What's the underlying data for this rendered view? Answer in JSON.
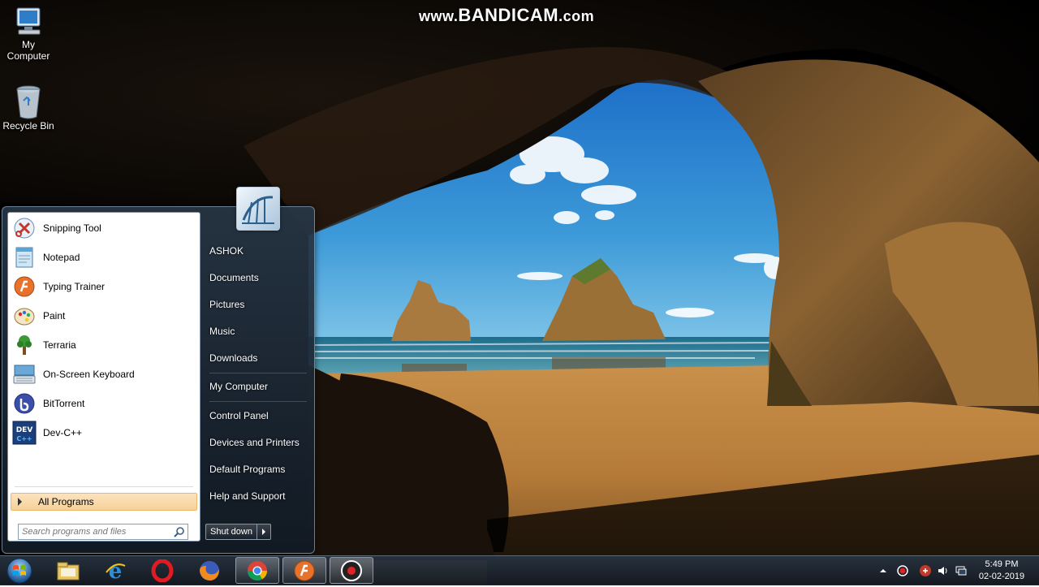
{
  "watermark": {
    "prefix": "www.",
    "brand": "BANDICAM",
    "suffix": ".com"
  },
  "desktop": {
    "icons": [
      {
        "label_line1": "My",
        "label_line2": "Computer",
        "icon": "computer-icon"
      },
      {
        "label_line1": "Recycle Bin",
        "label_line2": "",
        "icon": "recycle-bin-icon"
      }
    ]
  },
  "start_menu": {
    "programs": [
      {
        "label": "Snipping Tool",
        "icon": "snipping-tool-icon"
      },
      {
        "label": "Notepad",
        "icon": "notepad-icon"
      },
      {
        "label": "Typing Trainer",
        "icon": "typing-trainer-icon"
      },
      {
        "label": "Paint",
        "icon": "paint-icon"
      },
      {
        "label": "Terraria",
        "icon": "terraria-icon"
      },
      {
        "label": "On-Screen Keyboard",
        "icon": "keyboard-icon"
      },
      {
        "label": "BitTorrent",
        "icon": "bittorrent-icon"
      },
      {
        "label": "Dev-C++",
        "icon": "devcpp-icon"
      }
    ],
    "all_programs": "All Programs",
    "search_placeholder": "Search programs and files",
    "right_items": [
      "ASHOK",
      "Documents",
      "Pictures",
      "Music",
      "Downloads",
      "My Computer",
      "Control Panel",
      "Devices and Printers",
      "Default Programs",
      "Help and Support"
    ],
    "shutdown_label": "Shut down"
  },
  "taskbar": {
    "pinned": [
      {
        "name": "windows-explorer-icon"
      },
      {
        "name": "internet-explorer-icon"
      },
      {
        "name": "opera-icon"
      },
      {
        "name": "firefox-icon"
      },
      {
        "name": "chrome-icon",
        "active": true
      },
      {
        "name": "typing-app-icon",
        "active": true
      },
      {
        "name": "bandicam-icon",
        "active": true
      }
    ],
    "clock": {
      "time": "5:49 PM",
      "date": "02-02-2019"
    }
  }
}
